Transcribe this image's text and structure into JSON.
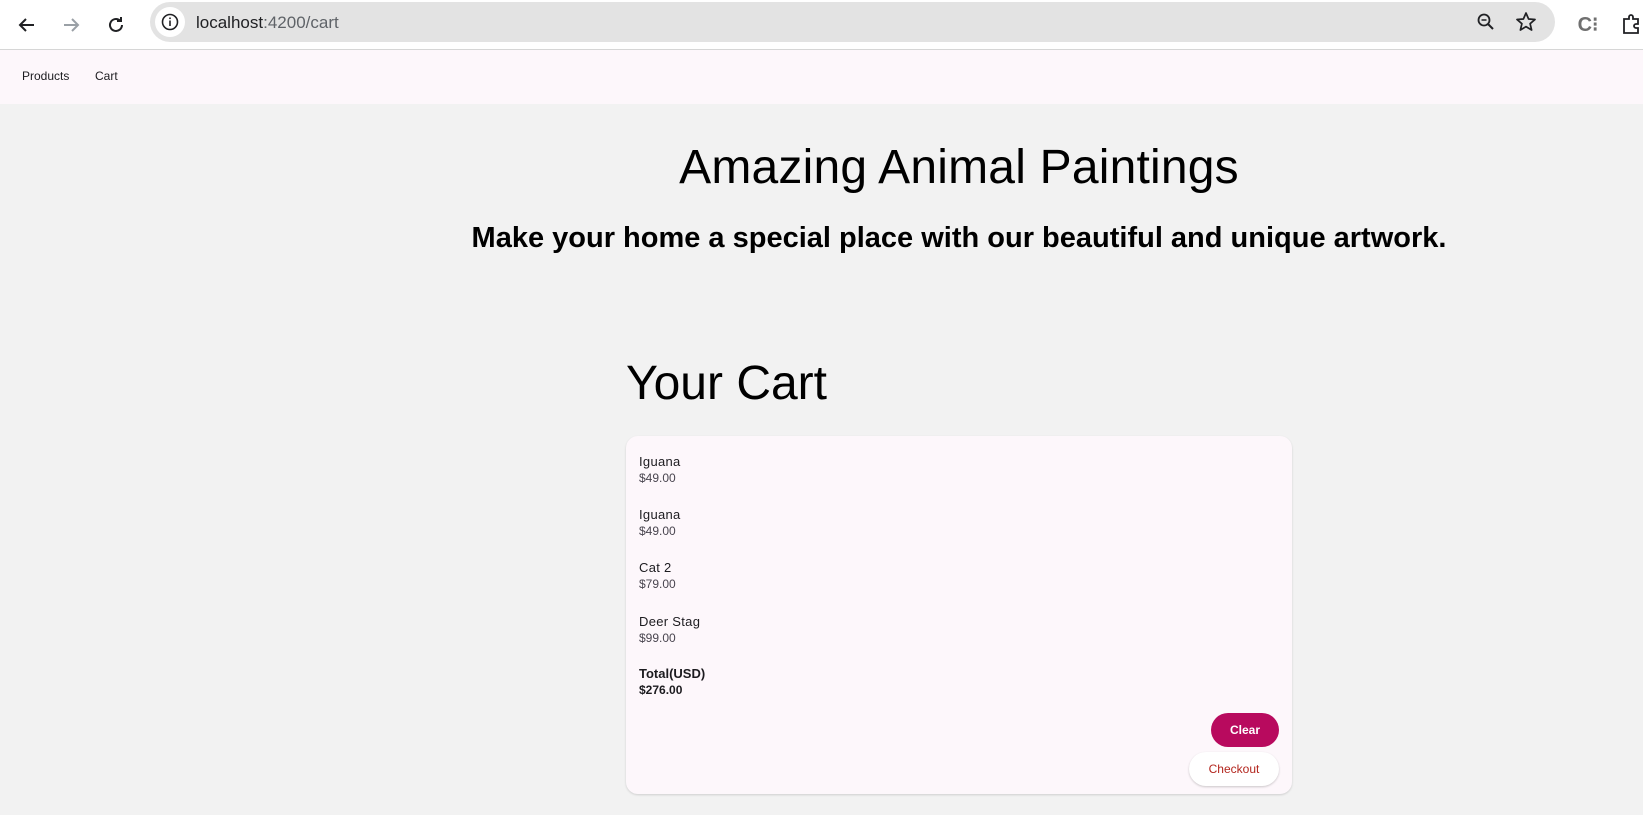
{
  "browser": {
    "url_host": "localhost",
    "url_path": ":4200/cart",
    "icons": [
      "back-arrow-icon",
      "forward-arrow-icon",
      "reload-icon",
      "site-info-icon",
      "zoom-icon",
      "bookmark-star-icon",
      "extension-c-icon",
      "extensions-puzzle-icon"
    ],
    "extension_glyph": "C⁝"
  },
  "toolbar": {
    "products_label": "Products",
    "cart_label": "Cart"
  },
  "hero": {
    "title": "Amazing Animal Paintings",
    "subtitle": "Make your home a special place with our beautiful and unique artwork."
  },
  "cart": {
    "heading": "Your Cart",
    "items": [
      {
        "name": "Iguana",
        "price": "$49.00"
      },
      {
        "name": "Iguana",
        "price": "$49.00"
      },
      {
        "name": "Cat 2",
        "price": "$79.00"
      },
      {
        "name": "Deer Stag",
        "price": "$99.00"
      }
    ],
    "total_label": "Total(USD)",
    "total_value": "$276.00",
    "clear_label": "Clear",
    "checkout_label": "Checkout"
  },
  "colors": {
    "accent": "#b80a5e",
    "checkout_text": "#b3261e",
    "card_bg": "#fdf7fb",
    "page_bg": "#f2f2f2"
  }
}
